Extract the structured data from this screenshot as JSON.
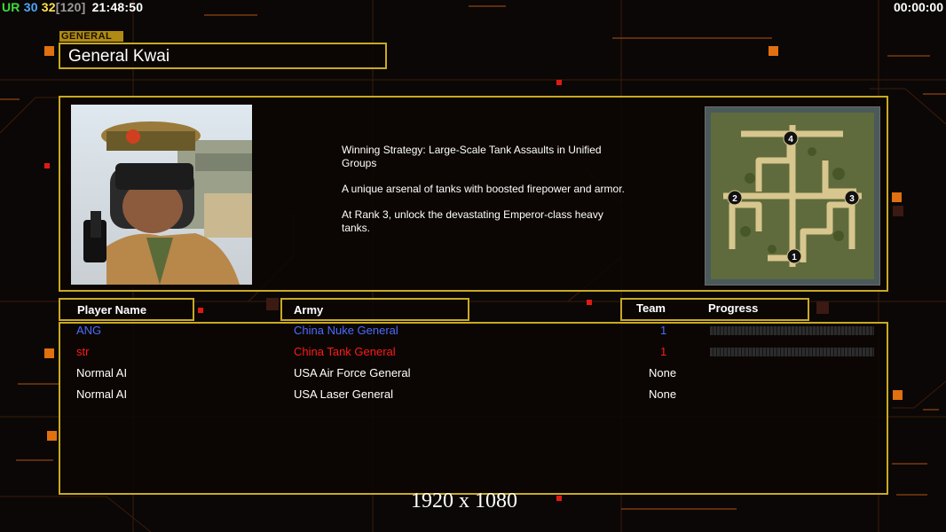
{
  "hud": {
    "ur_label": "UR",
    "ur_value": "30",
    "count_value": "32",
    "count_bracket": "[120]",
    "clock": "21:48:50",
    "timer": "00:00:00"
  },
  "general": {
    "tag": "GENERAL",
    "name": "General Kwai",
    "strategy": [
      "Winning Strategy: Large-Scale Tank Assaults in Unified Groups",
      "A unique arsenal of tanks with boosted firepower and armor.",
      "At Rank 3, unlock the devastating Emperor-class heavy tanks."
    ],
    "map_start_positions": [
      "1",
      "2",
      "3",
      "4"
    ]
  },
  "columns": {
    "player": "Player Name",
    "army": "Army",
    "team": "Team",
    "progress": "Progress"
  },
  "players": [
    {
      "name": "ANG",
      "army": "China Nuke General",
      "team": "1",
      "color": "#4a6cff",
      "progress": 0
    },
    {
      "name": "str",
      "army": "China Tank General",
      "team": "1",
      "color": "#ff1a1a",
      "progress": 0
    },
    {
      "name": "Normal AI",
      "army": "USA Air Force General",
      "team": "None",
      "color": "#ffffff"
    },
    {
      "name": "Normal AI",
      "army": "USA Laser General",
      "team": "None",
      "color": "#ffffff"
    }
  ],
  "resolution_label": "1920 x 1080",
  "colors": {
    "accent_gold": "#c8a922",
    "ur_green": "#3ddc3d",
    "ur_value_blue": "#4aa8ff",
    "count_yellow": "#ffe34a",
    "bracket_grey": "#9a9a9a",
    "bg_orange": "#e07010"
  }
}
